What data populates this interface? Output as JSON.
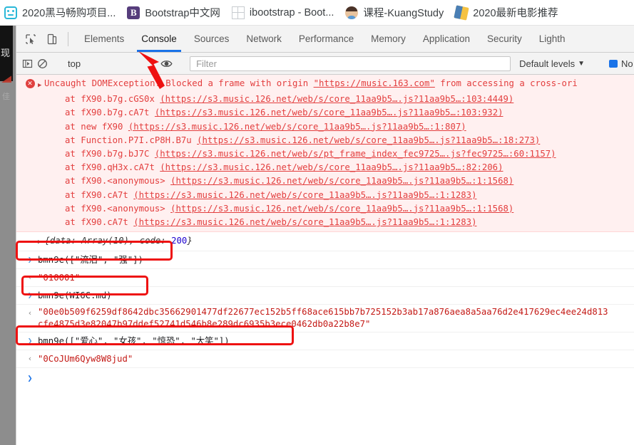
{
  "bookmarks": [
    {
      "label": "2020黑马畅购项目...",
      "icon": "robot-icon"
    },
    {
      "label": "Bootstrap中文网",
      "icon": "bootstrap-b-icon"
    },
    {
      "label": "ibootstrap - Boot...",
      "icon": "grid-icon"
    },
    {
      "label": "课程-KuangStudy",
      "icon": "avatar-icon"
    },
    {
      "label": "2020最新电影推荐",
      "icon": "diamond-icon"
    }
  ],
  "page_behind": {
    "dark_text": "现",
    "grey_text": "佳"
  },
  "devtools": {
    "tabs": [
      {
        "label": "Elements",
        "active": false
      },
      {
        "label": "Console",
        "active": true
      },
      {
        "label": "Sources",
        "active": false
      },
      {
        "label": "Network",
        "active": false
      },
      {
        "label": "Performance",
        "active": false
      },
      {
        "label": "Memory",
        "active": false
      },
      {
        "label": "Application",
        "active": false
      },
      {
        "label": "Security",
        "active": false
      },
      {
        "label": "Lighth",
        "active": false
      }
    ],
    "active_tab_accent": "#1a73e8",
    "inspect_icon": "inspect-cursor-icon",
    "device_icon": "device-toolbar-icon"
  },
  "console_toolbar": {
    "execute_icon": "execute-sidebar-icon",
    "clear_icon": "clear-console-icon",
    "context": "top",
    "eye_icon": "live-expression-eye-icon",
    "filter_placeholder": "Filter",
    "filter_value": "",
    "levels_label": "Default levels",
    "levels_caret": "▼",
    "issues_label": "No Issues",
    "issues_icon": "issues-message-icon"
  },
  "console": {
    "error": {
      "icon": "error-circle-icon",
      "expand_caret": "▶",
      "message_pre": "Uncaught DOMException: Blocked a frame with origin ",
      "message_origin": "\"https://music.163.com\"",
      "message_post": " from accessing a cross-ori",
      "stack": [
        {
          "fn": "at fX90.b7g.cGS0x",
          "url": "(https://s3.music.126.net/web/s/core_11aa9b5….js?11aa9b5…:103:4449)"
        },
        {
          "fn": "at fX90.b7g.cA7t",
          "url": "(https://s3.music.126.net/web/s/core_11aa9b5….js?11aa9b5…:103:932)"
        },
        {
          "fn": "at new fX90",
          "url": "(https://s3.music.126.net/web/s/core_11aa9b5….js?11aa9b5…:1:807)"
        },
        {
          "fn": "at Function.P7I.cP8H.B7u",
          "url": "(https://s3.music.126.net/web/s/core_11aa9b5….js?11aa9b5…:18:273)"
        },
        {
          "fn": "at fX90.b7g.bJ7C",
          "url": "(https://s3.music.126.net/web/s/pt_frame_index_fec9725….js?fec9725…:60:1157)"
        },
        {
          "fn": "at fX90.qH3x.cA7t",
          "url": "(https://s3.music.126.net/web/s/core_11aa9b5….js?11aa9b5…:82:206)"
        },
        {
          "fn": "at fX90.<anonymous>",
          "url": "(https://s3.music.126.net/web/s/core_11aa9b5….js?11aa9b5…:1:1568)"
        },
        {
          "fn": "at fX90.cA7t",
          "url": "(https://s3.music.126.net/web/s/core_11aa9b5….js?11aa9b5…:1:1283)"
        },
        {
          "fn": "at fX90.<anonymous>",
          "url": "(https://s3.music.126.net/web/s/core_11aa9b5….js?11aa9b5…:1:1568)"
        },
        {
          "fn": "at fX90.cA7t",
          "url": "(https://s3.music.126.net/web/s/core_11aa9b5….js?11aa9b5…:1:1283)"
        }
      ]
    },
    "entries": [
      {
        "kind": "object-preview",
        "caret": "▶",
        "text_before": "{data: Array(10), code: ",
        "value": "200",
        "text_after": "}"
      },
      {
        "kind": "input",
        "arrow": "❯",
        "text": "bmn9e([\"流泪\", \"强\"])",
        "highlighted": true
      },
      {
        "kind": "output",
        "arrow": "‹",
        "text": "\"010001\"",
        "highlighted": false
      },
      {
        "kind": "input",
        "arrow": "❯",
        "text": "bmn9e(WI6C.md)",
        "highlighted": true
      },
      {
        "kind": "output",
        "arrow": "‹",
        "text": "\"00e0b509f6259df8642dbc35662901477df22677ec152b5ff68ace615bb7b725152b3ab17a876aea8a5aa76d2e417629ec4ee24d813cfe4875d3e82047b97ddef52741d546b8e289dc6935b3ece0462db0a22b8e7\"",
        "highlighted": false,
        "wrap": true
      },
      {
        "kind": "input",
        "arrow": "❯",
        "text": "bmn9e([\"爱心\", \"女孩\", \"惊恐\", \"大笑\"])",
        "highlighted": true
      },
      {
        "kind": "output",
        "arrow": "‹",
        "text": "\"0CoJUm6Qyw8W8jud\"",
        "highlighted": false
      }
    ],
    "prompt_caret": "❯",
    "prompt_value": ""
  },
  "annotations": {
    "arrow_color": "#ee1111",
    "box_color": "#ee1111",
    "arrow_target": "Console tab",
    "highlight_boxes": 3
  }
}
